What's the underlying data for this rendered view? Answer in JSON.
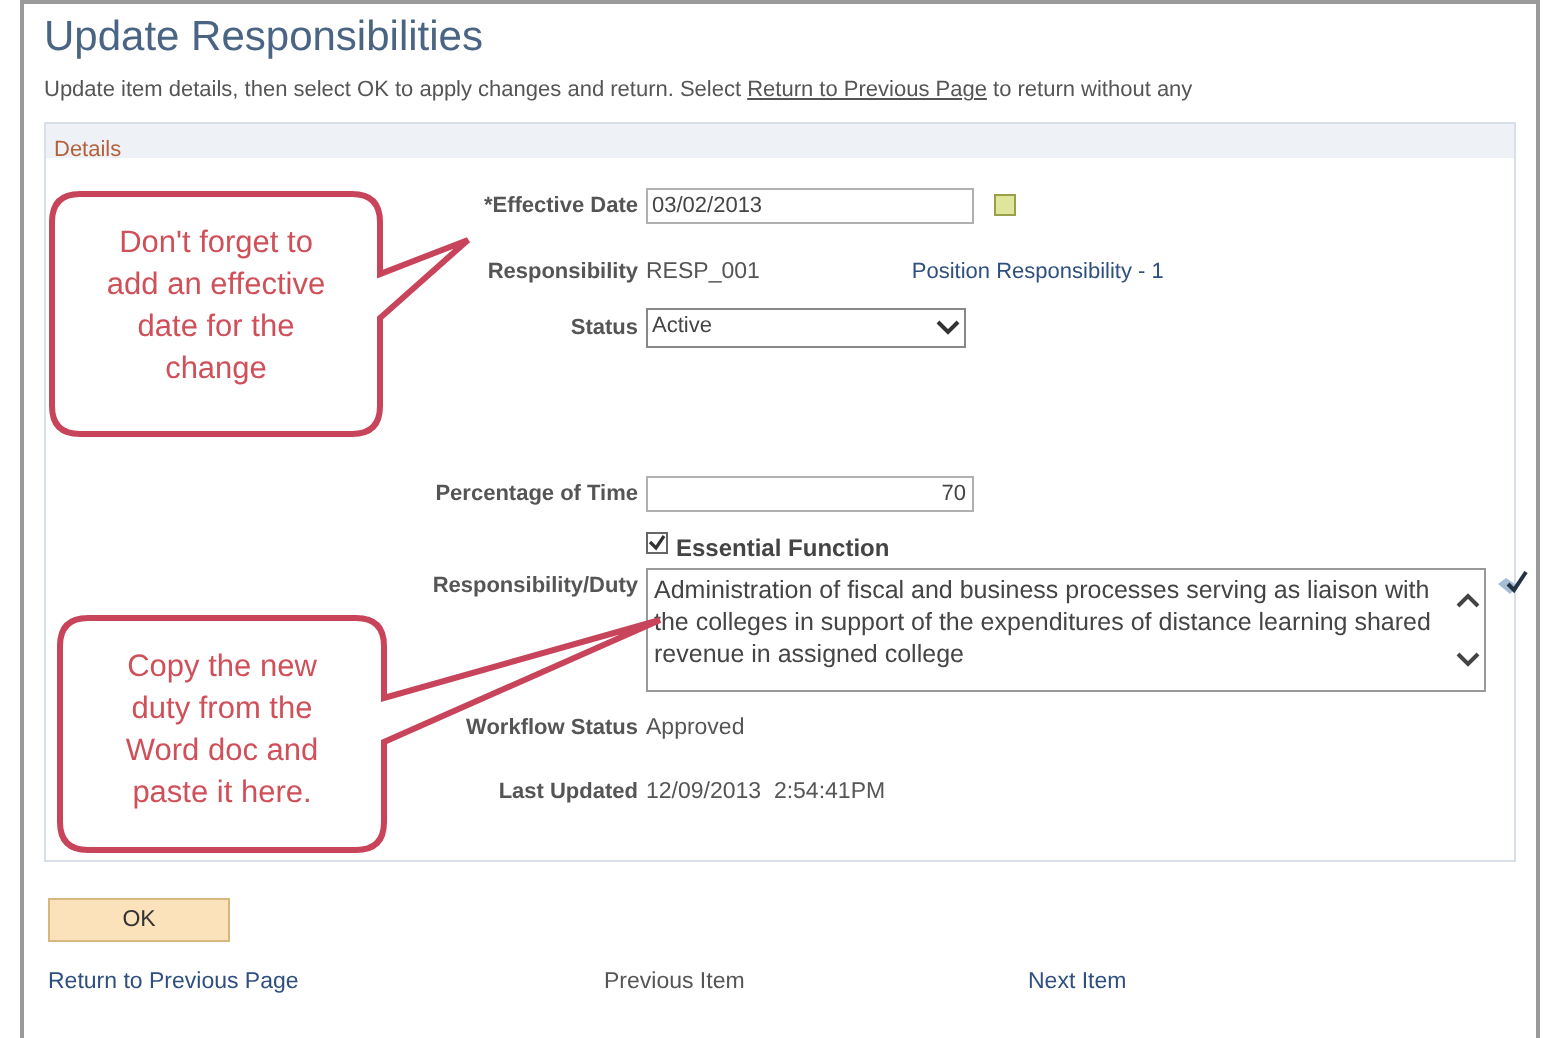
{
  "title": "Update Responsibilities",
  "instruction": {
    "before": "Update item details, then select OK to apply changes and return. Select",
    "link": "Return to Previous Page",
    "after": "to return without any"
  },
  "section": "Details",
  "fields": [
    {
      "kind": "date",
      "label": "*Effective Date",
      "value": "03/02/2013"
    },
    {
      "kind": "text",
      "label": "Responsibility",
      "value": "RESP_001",
      "aside": "Position Responsibility - 1"
    },
    {
      "kind": "select",
      "label": "Status",
      "value": "Active"
    },
    {
      "kind": "number",
      "label": "Percentage of Time",
      "value": "70"
    },
    {
      "kind": "checkbox",
      "label": "Essential Function",
      "checked": true
    },
    {
      "kind": "longtext",
      "label": "Responsibility/Duty",
      "value": "Administration of fiscal and business processes serving as liaison with the colleges in support of the expenditures of distance learning shared revenue in assigned college"
    },
    {
      "kind": "text",
      "label": "Workflow Status",
      "value": "Approved"
    },
    {
      "kind": "text",
      "label": "Last Updated",
      "value": "12/09/2013  2:54:41PM"
    }
  ],
  "callouts": [
    "Don't forget to add an effective date for the change",
    "Copy the new duty from the Word doc and paste it here."
  ],
  "ok_button": "OK",
  "nav": [
    "Return to Previous Page",
    "Previous Item",
    "Next Item"
  ]
}
